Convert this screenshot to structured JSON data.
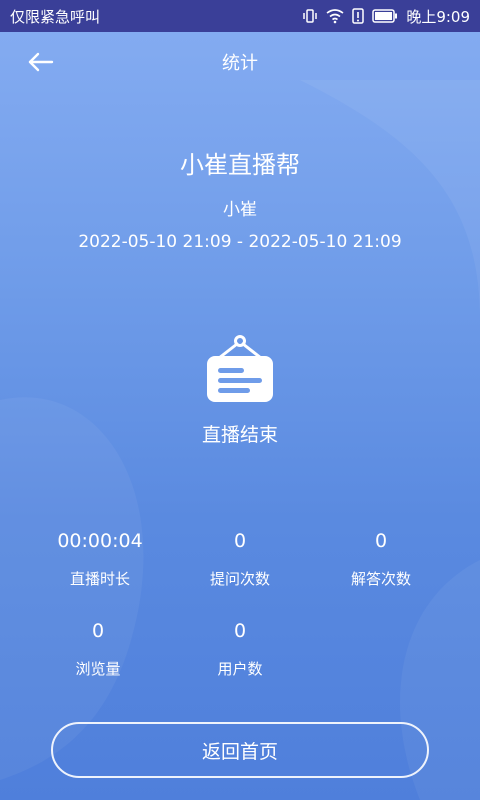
{
  "status_bar": {
    "left_text": "仅限紧急呼叫",
    "time": "晚上9:09",
    "icons": [
      "vibrate-icon",
      "wifi-icon",
      "sim-alert-icon",
      "battery-icon"
    ]
  },
  "header": {
    "title": "统计",
    "back_icon": "back-arrow-icon"
  },
  "live": {
    "title": "小崔直播帮",
    "host": "小崔",
    "time_range": "2022-05-10 21:09 - 2022-05-10 21:09",
    "status_icon": "hanging-sign-icon",
    "status_text": "直播结束"
  },
  "stats": [
    {
      "value": "00:00:04",
      "label": "直播时长"
    },
    {
      "value": "0",
      "label": "提问次数"
    },
    {
      "value": "0",
      "label": "解答次数"
    },
    {
      "value": "0",
      "label": "浏览量"
    },
    {
      "value": "0",
      "label": "用户数"
    }
  ],
  "actions": {
    "home_label": "返回首页"
  },
  "colors": {
    "status_bar": "#3a3f98",
    "bg_top": "#86adf2",
    "bg_bottom": "#4f7fdb",
    "text": "#ffffff"
  }
}
